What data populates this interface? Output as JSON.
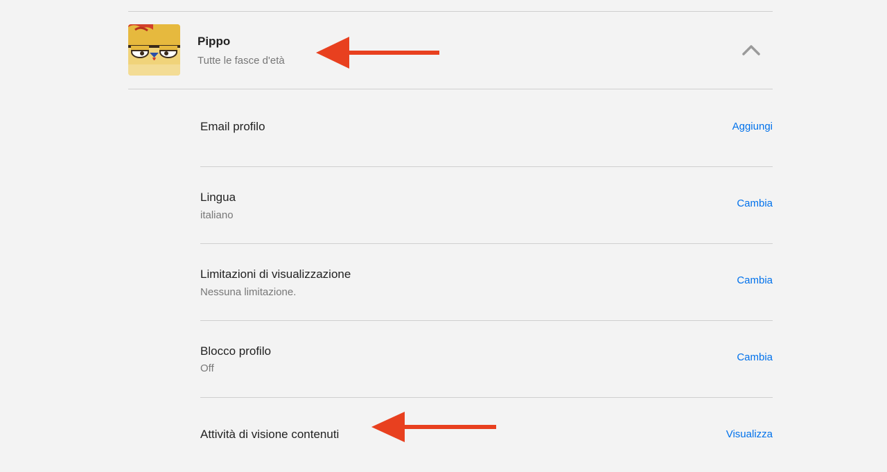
{
  "profile": {
    "name": "Pippo",
    "subtitle": "Tutte le fasce d'età",
    "avatar_icon": "cartoon-chicken-avatar",
    "toggle_icon": "chevron-up-icon"
  },
  "settings": [
    {
      "title": "Email profilo",
      "value": "",
      "action": "Aggiungi"
    },
    {
      "title": "Lingua",
      "value": "italiano",
      "action": "Cambia"
    },
    {
      "title": "Limitazioni di visualizzazione",
      "value": "Nessuna limitazione.",
      "action": "Cambia"
    },
    {
      "title": "Blocco profilo",
      "value": "Off",
      "action": "Cambia"
    },
    {
      "title": "Attività di visione contenuti",
      "value": "",
      "action": "Visualizza"
    }
  ],
  "colors": {
    "background": "#f3f3f3",
    "link": "#0071eb",
    "annotation_arrow": "#e8401f",
    "divider": "#cfcfcf"
  },
  "annotations": {
    "arrow_icon": "red-left-arrow-icon"
  }
}
